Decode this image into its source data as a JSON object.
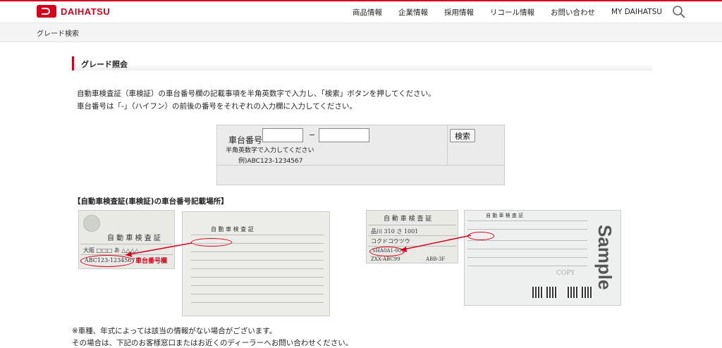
{
  "header": {
    "logo_text": "DAIHATSU",
    "nav": [
      "商品情報",
      "企業情報",
      "採用情報",
      "リコール情報",
      "お問い合わせ",
      "MY DAIHATSU"
    ]
  },
  "breadcrumb": "グレード検索",
  "section_title": "グレード照会",
  "description": [
    "自動車検査証（車検証）の車台番号欄の記載事項を半角英数字で入力し、「検索」ボタンを押してください。",
    "車台番号は「-」（ハイフン）の前後の番号をそれぞれの入力欄に入力してください。"
  ],
  "form": {
    "label": "車台番号",
    "input1_value": "",
    "input2_value": "",
    "dash": "−",
    "hint": "半角英数字で入力してください",
    "example": "例)ABC123-1234567",
    "search_button": "検索"
  },
  "cert_heading": "【自動車検査証(車検証)の車台番号記載場所】",
  "cert_left": {
    "title": "自 動 車 検 査 証",
    "plate": "大阪 □□□ あ △△△△",
    "vin": "ABC123-1234567",
    "callout": "車台番号欄"
  },
  "cert_right": {
    "title": "自 動 車 検 査 証",
    "plate": "品川 310 さ 1001",
    "kana": "コクドコウツウ",
    "vin": "SHA0A1-001",
    "model": "ZXX-ABC99",
    "engine": "ABB-3F",
    "watermark": "Sample",
    "copy": "COPY"
  },
  "notes": [
    "※車種、年式によっては該当の情報がない場合がございます。",
    "その場合は、下記のお客様窓口またはお近くのディーラーへお問い合わせください。"
  ],
  "colors": {
    "brand_red": "#d6001c"
  }
}
